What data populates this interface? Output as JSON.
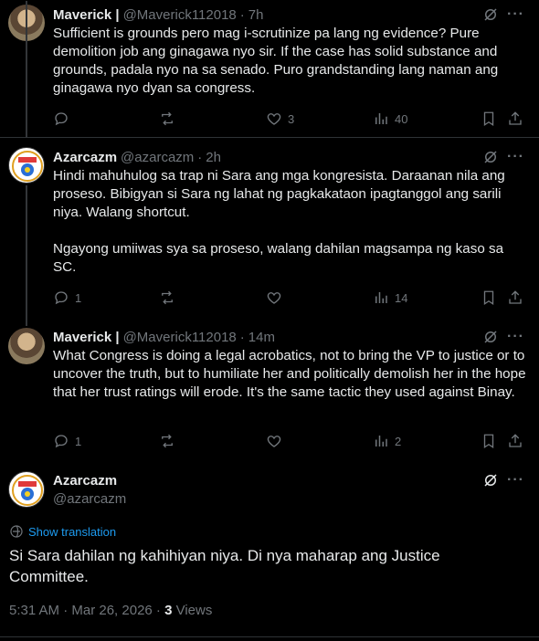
{
  "tweets": [
    {
      "name": "Maverick |",
      "handle": "@Maverick112018",
      "time": "7h",
      "text": "Sufficient is grounds pero mag i-scrutinize pa lang ng evidence? Pure demolition job ang ginagawa nyo sir. If the case has solid substance and grounds, padala nyo na sa senado. Puro grandstanding lang naman ang ginagawa nyo dyan sa congress.",
      "replies": "",
      "reposts": "",
      "likes": "3",
      "views": "40"
    },
    {
      "name": "Azarcazm",
      "handle": "@azarcazm",
      "time": "2h",
      "text": "Hindi mahuhulog sa trap ni Sara ang mga kongresista. Daraanan nila ang proseso. Bibigyan si Sara ng lahat ng pagkakataon ipagtanggol ang sarili niya. Walang shortcut.\n\nNgayong umiiwas sya sa proseso, walang dahilan magsampa ng kaso sa SC.",
      "replies": "1",
      "reposts": "",
      "likes": "",
      "views": "14"
    },
    {
      "name": "Maverick |",
      "handle": "@Maverick112018",
      "time": "14m",
      "text": "What Congress is doing a legal acrobatics, not to bring the VP to justice or to uncover the truth, but to humiliate her and politically demolish her in the hope that her trust ratings will erode. It's the same tactic they used against Binay.",
      "replies": "1",
      "reposts": "",
      "likes": "",
      "views": "2"
    }
  ],
  "main_tweet": {
    "name": "Azarcazm",
    "handle": "@azarcazm",
    "show_translation": "Show translation",
    "text": "Si Sara dahilan ng kahihiyan niya. Di nya maharap ang Justice Committee.",
    "timestamp": "5:31 AM · Mar 26, 2026 ·",
    "views_count": "3",
    "views_label": "Views"
  },
  "separator": "·",
  "icons": {
    "reply": "reply-icon",
    "repost": "repost-icon",
    "like": "like-icon",
    "views": "views-icon",
    "bookmark": "bookmark-icon",
    "share": "share-icon",
    "grok": "grok-icon",
    "more": "more-icon",
    "translate": "translate-icon"
  },
  "colors": {
    "background": "#000000",
    "text": "#e7e9ea",
    "muted": "#71767b",
    "link": "#1d9bf0",
    "divider": "#2f3336"
  }
}
